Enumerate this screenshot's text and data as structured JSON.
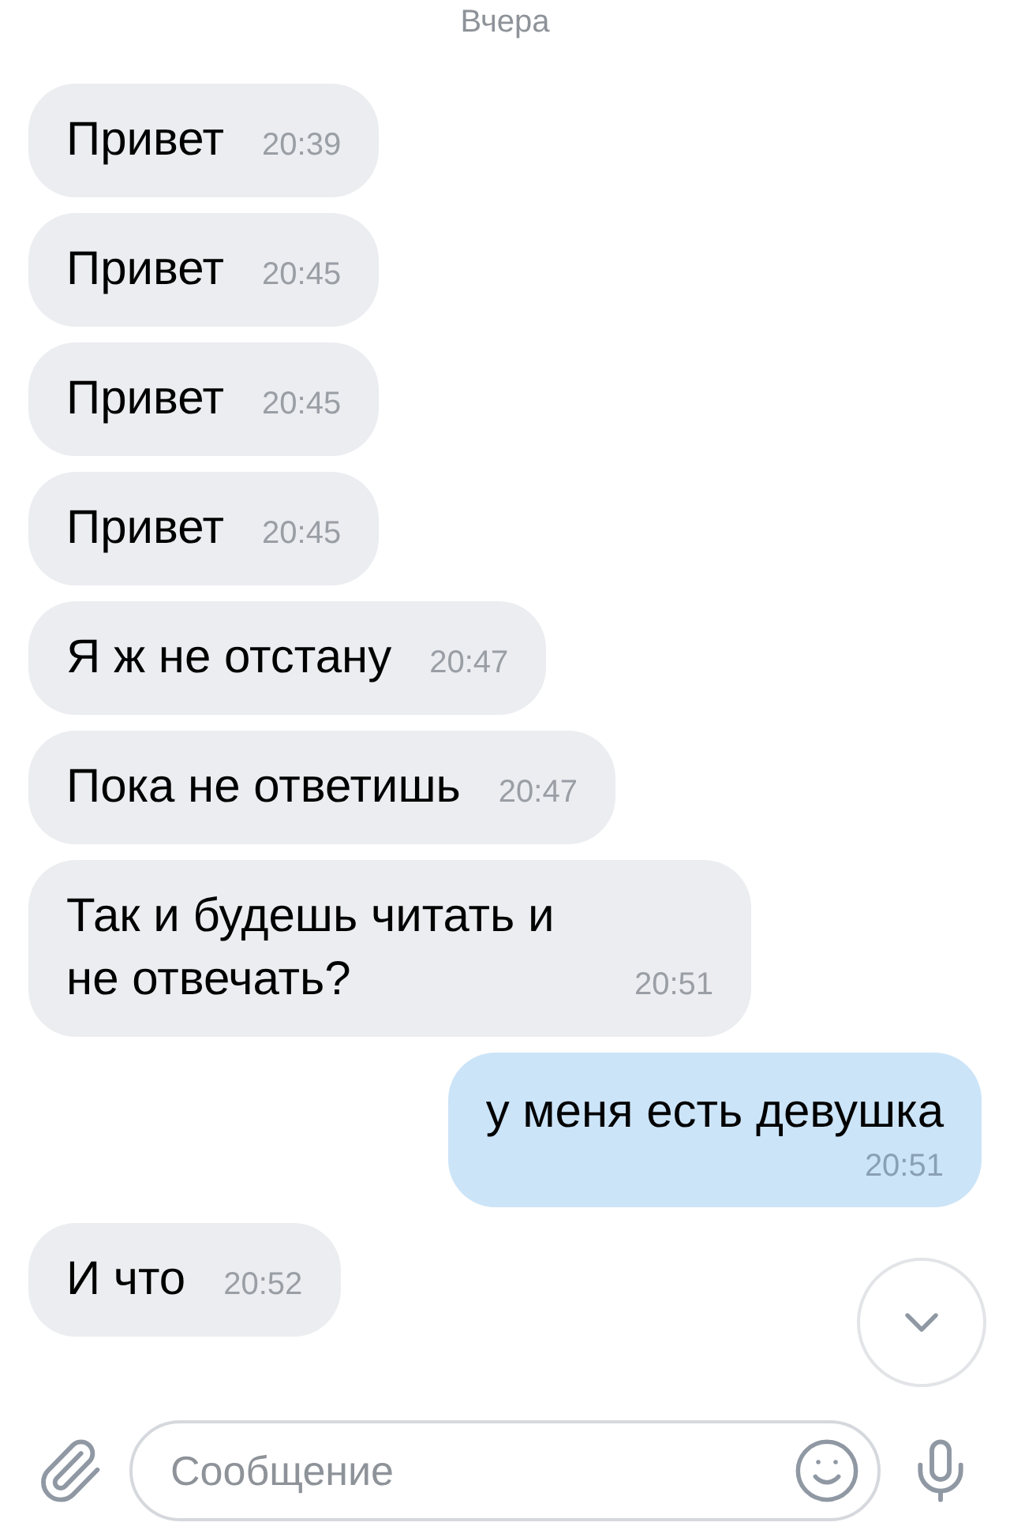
{
  "date_divider": "Вчера",
  "messages": [
    {
      "kind": "in",
      "text": "Привет",
      "time": "20:39"
    },
    {
      "kind": "in",
      "text": "Привет",
      "time": "20:45"
    },
    {
      "kind": "in",
      "text": "Привет",
      "time": "20:45"
    },
    {
      "kind": "in",
      "text": "Привет",
      "time": "20:45"
    },
    {
      "kind": "in",
      "text": "Я ж не отстану",
      "time": "20:47"
    },
    {
      "kind": "in",
      "text": "Пока не ответишь",
      "time": "20:47"
    },
    {
      "kind": "in",
      "text": "Так и будешь читать и не отвечать?",
      "time": "20:51"
    },
    {
      "kind": "out",
      "text": "у меня есть девушка",
      "time": "20:51"
    },
    {
      "kind": "in",
      "text": "И что",
      "time": "20:52"
    }
  ],
  "composer": {
    "placeholder": "Сообщение"
  }
}
